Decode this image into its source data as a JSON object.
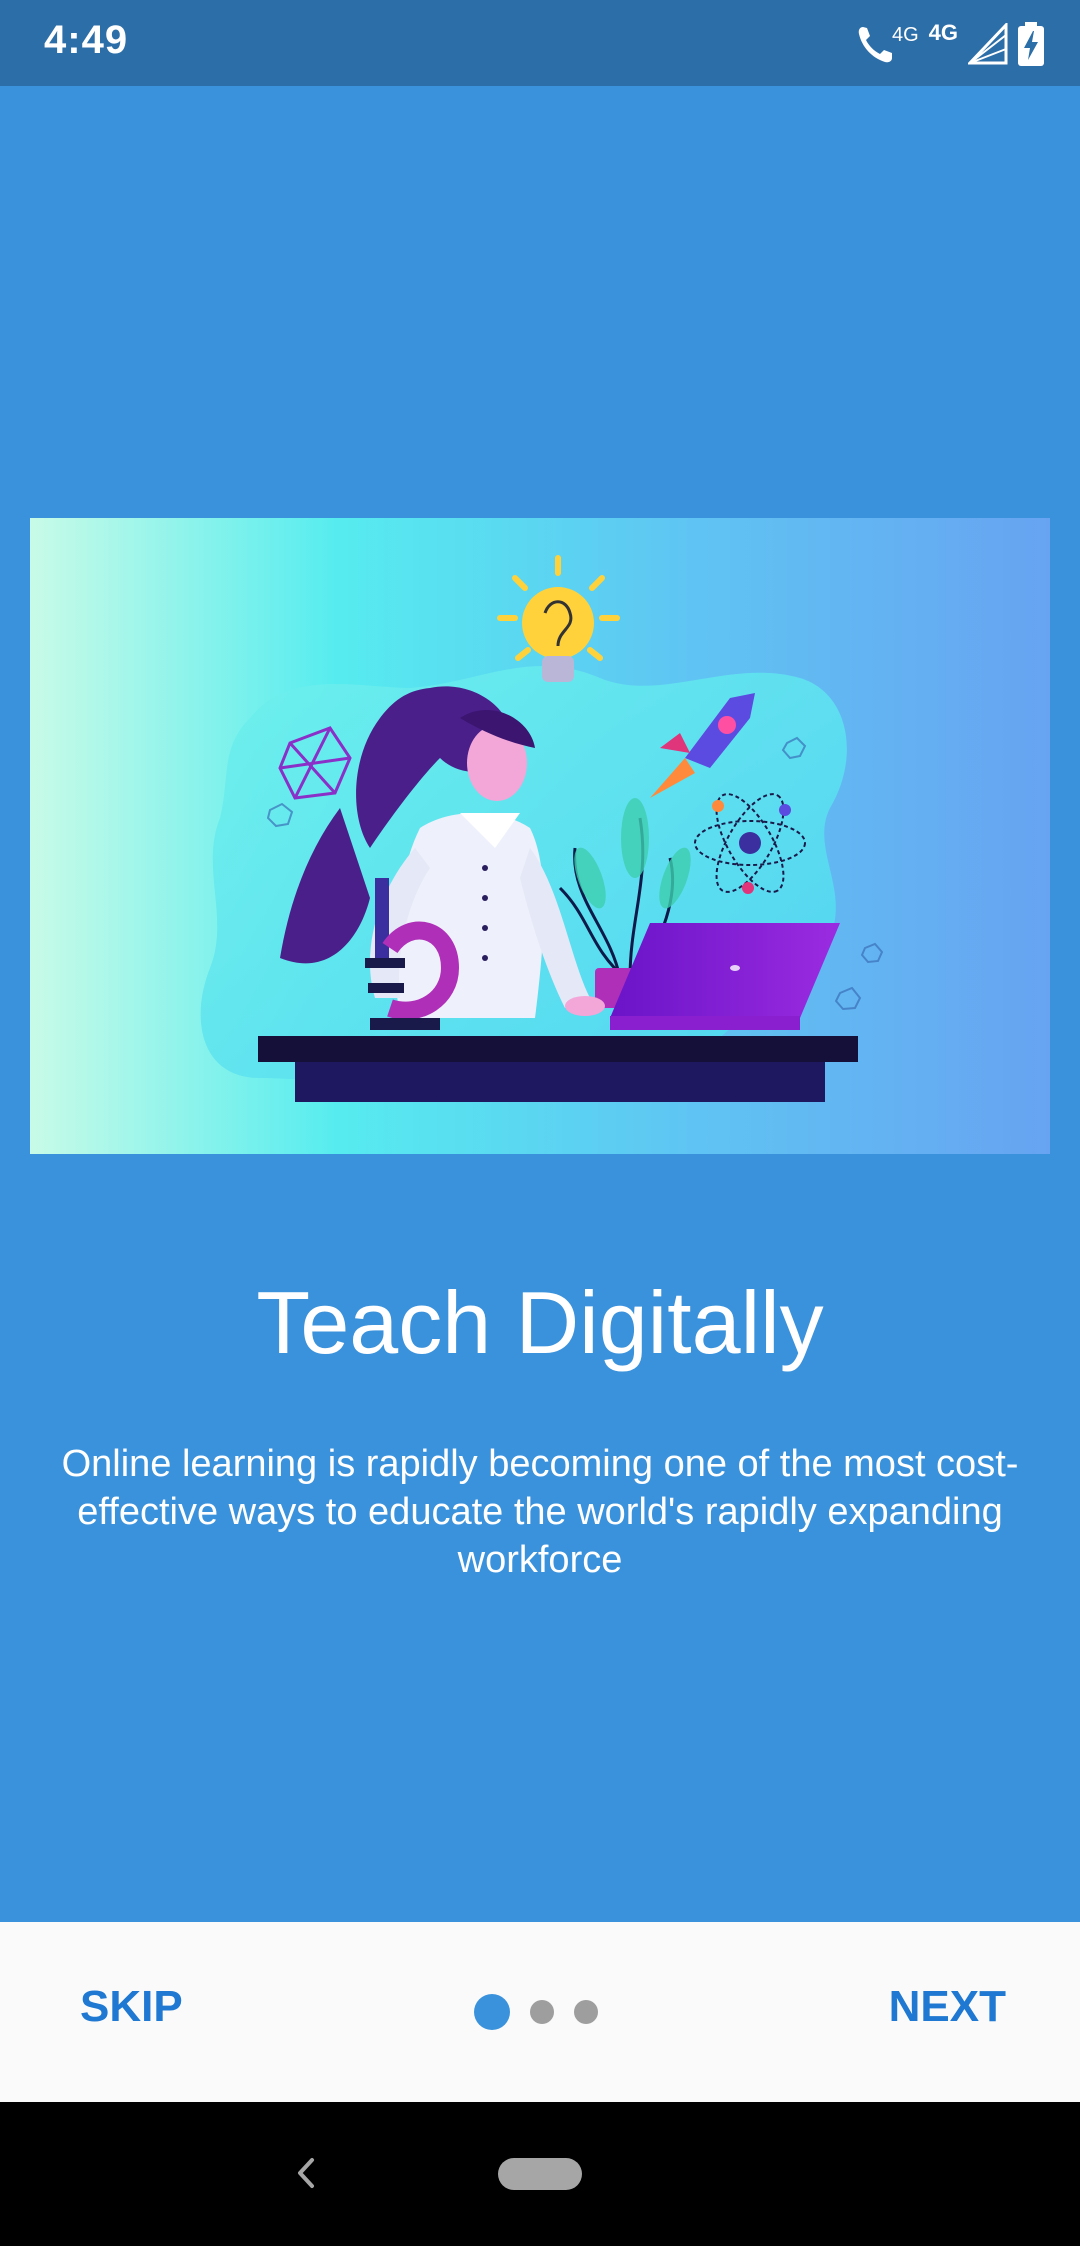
{
  "status_bar": {
    "time": "4:49",
    "network_label": "4G",
    "network_label_2": "4G",
    "icons": [
      "phone-wifi-calling-icon",
      "signal-icon",
      "battery-charging-icon"
    ]
  },
  "onboarding": {
    "title": "Teach Digitally",
    "description": "Online learning is rapidly becoming one of the most cost-effective ways to educate the world's rapidly expanding workforce",
    "page_index": 1,
    "page_count": 3
  },
  "bottom_bar": {
    "skip_label": "SKIP",
    "next_label": "NEXT"
  },
  "colors": {
    "background": "#3a92dc",
    "status_bar": "#2c6ea8",
    "accent": "#1f78d1",
    "bottom_bar": "#fafafa"
  }
}
